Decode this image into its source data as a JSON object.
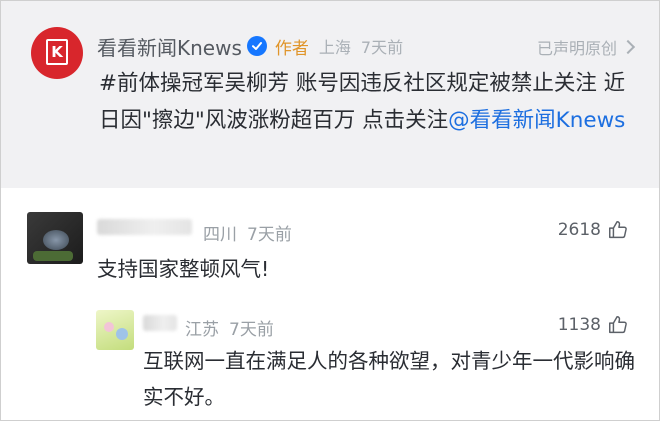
{
  "post": {
    "author_name": "看看新闻Knews",
    "author_tag": "作者",
    "location": "上海",
    "time": "7天前",
    "original_label": "已声明原创",
    "text_main": "#前体操冠军吴柳芳 账号因违反社区规定被禁止关注 近日因\"擦边\"风波涨粉超百万 点击关注",
    "text_link": "@看看新闻Knews"
  },
  "comments": [
    {
      "location": "四川",
      "time": "7天前",
      "likes": "2618",
      "text": "支持国家整顿风气!"
    },
    {
      "location": "江苏",
      "time": "7天前",
      "likes": "1138",
      "text": "互联网一直在满足人的各种欲望，对青少年一代影响确实不好。"
    }
  ],
  "icons": {
    "verified": "verified-badge-icon",
    "chevron": "chevron-right-icon",
    "like": "thumbs-up-icon"
  },
  "colors": {
    "brand_red": "#d8262c",
    "link_blue": "#1d6fe0",
    "author_tag": "#e0952a",
    "verified_blue": "#1677ff"
  }
}
